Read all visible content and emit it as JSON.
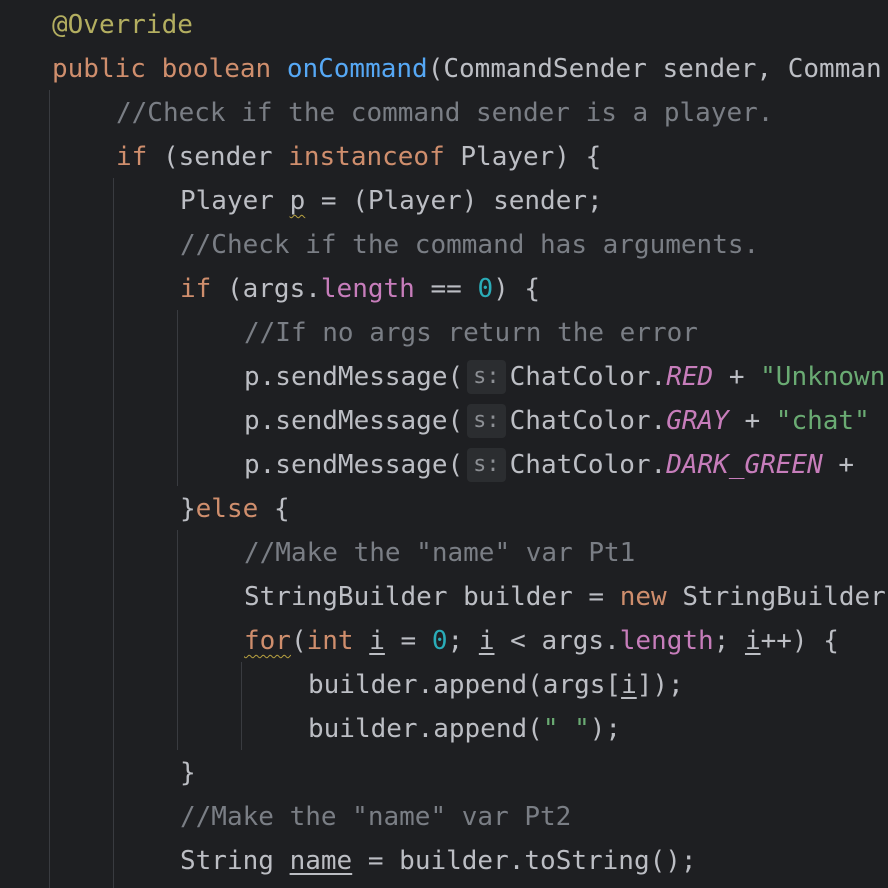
{
  "editor": {
    "theme_colors": {
      "background": "#1e1f22",
      "keyword": "#cf8e6d",
      "annotation": "#b3ae60",
      "method_decl": "#56a8f5",
      "comment": "#7a7e85",
      "field": "#c77dbb",
      "number": "#2aacb8",
      "string": "#6aab73",
      "default": "#bcbec4"
    },
    "lines": [
      {
        "indent": 0,
        "tokens": [
          {
            "t": "@Override",
            "c": "ann"
          }
        ]
      },
      {
        "indent": 0,
        "tokens": [
          {
            "t": "public ",
            "c": "kw"
          },
          {
            "t": "boolean ",
            "c": "kw"
          },
          {
            "t": "onCommand",
            "c": "fn"
          },
          {
            "t": "(CommandSender sender, Comman"
          }
        ]
      },
      {
        "indent": 1,
        "tokens": [
          {
            "t": "//Check if the command sender is a player.",
            "c": "cmt"
          }
        ]
      },
      {
        "indent": 1,
        "tokens": [
          {
            "t": "if ",
            "c": "kw"
          },
          {
            "t": "(sender "
          },
          {
            "t": "instanceof ",
            "c": "kw"
          },
          {
            "t": "Player) {"
          }
        ]
      },
      {
        "indent": 2,
        "tokens": [
          {
            "t": "Player "
          },
          {
            "t": "p",
            "c": "warn"
          },
          {
            "t": " = (Player) sender;"
          }
        ]
      },
      {
        "indent": 2,
        "tokens": [
          {
            "t": "//Check if the command has arguments.",
            "c": "cmt"
          }
        ]
      },
      {
        "indent": 2,
        "tokens": [
          {
            "t": "if ",
            "c": "kw"
          },
          {
            "t": "(args."
          },
          {
            "t": "length",
            "c": "fld"
          },
          {
            "t": " == "
          },
          {
            "t": "0",
            "c": "num"
          },
          {
            "t": ") {"
          }
        ]
      },
      {
        "indent": 3,
        "tokens": [
          {
            "t": "//If no args return the error",
            "c": "cmt"
          }
        ]
      },
      {
        "indent": 3,
        "tokens": [
          {
            "t": "p.sendMessage("
          },
          {
            "t": "s:",
            "c": "hint"
          },
          {
            "t": "ChatColor."
          },
          {
            "t": "RED",
            "c": "const"
          },
          {
            "t": " + "
          },
          {
            "t": "\"Unknown",
            "c": "str"
          }
        ]
      },
      {
        "indent": 3,
        "tokens": [
          {
            "t": "p.sendMessage("
          },
          {
            "t": "s:",
            "c": "hint"
          },
          {
            "t": "ChatColor."
          },
          {
            "t": "GRAY",
            "c": "const"
          },
          {
            "t": " + "
          },
          {
            "t": "\"chat\"",
            "c": "str"
          }
        ]
      },
      {
        "indent": 3,
        "tokens": [
          {
            "t": "p.sendMessage("
          },
          {
            "t": "s:",
            "c": "hint"
          },
          {
            "t": "ChatColor."
          },
          {
            "t": "DARK_GREEN",
            "c": "const"
          },
          {
            "t": " + "
          }
        ]
      },
      {
        "indent": 2,
        "tokens": [
          {
            "t": "}"
          },
          {
            "t": "else ",
            "c": "kw"
          },
          {
            "t": "{"
          }
        ]
      },
      {
        "indent": 3,
        "tokens": [
          {
            "t": "//Make the \"name\" var Pt1",
            "c": "cmt"
          }
        ]
      },
      {
        "indent": 3,
        "tokens": [
          {
            "t": "StringBuilder builder = "
          },
          {
            "t": "new ",
            "c": "kw"
          },
          {
            "t": "StringBuilder"
          }
        ]
      },
      {
        "indent": 3,
        "tokens": [
          {
            "t": "for",
            "c": "kw warn"
          },
          {
            "t": "("
          },
          {
            "t": "int ",
            "c": "kw"
          },
          {
            "t": "i",
            "c": "ul"
          },
          {
            "t": " = "
          },
          {
            "t": "0",
            "c": "num"
          },
          {
            "t": "; "
          },
          {
            "t": "i",
            "c": "ul"
          },
          {
            "t": " < args."
          },
          {
            "t": "length",
            "c": "fld"
          },
          {
            "t": "; "
          },
          {
            "t": "i",
            "c": "ul"
          },
          {
            "t": "++) {"
          }
        ]
      },
      {
        "indent": 4,
        "tokens": [
          {
            "t": "builder.append(args["
          },
          {
            "t": "i",
            "c": "ul"
          },
          {
            "t": "]);"
          }
        ]
      },
      {
        "indent": 4,
        "tokens": [
          {
            "t": "builder.append("
          },
          {
            "t": "\" \"",
            "c": "str"
          },
          {
            "t": ");"
          }
        ]
      },
      {
        "indent": 2,
        "tokens": [
          {
            "t": "}"
          }
        ]
      },
      {
        "indent": 2,
        "tokens": [
          {
            "t": "//Make the \"name\" var Pt2",
            "c": "cmt"
          }
        ]
      },
      {
        "indent": 2,
        "tokens": [
          {
            "t": "String "
          },
          {
            "t": "name",
            "c": "ul"
          },
          {
            "t": " = builder.toString();"
          }
        ]
      }
    ]
  }
}
